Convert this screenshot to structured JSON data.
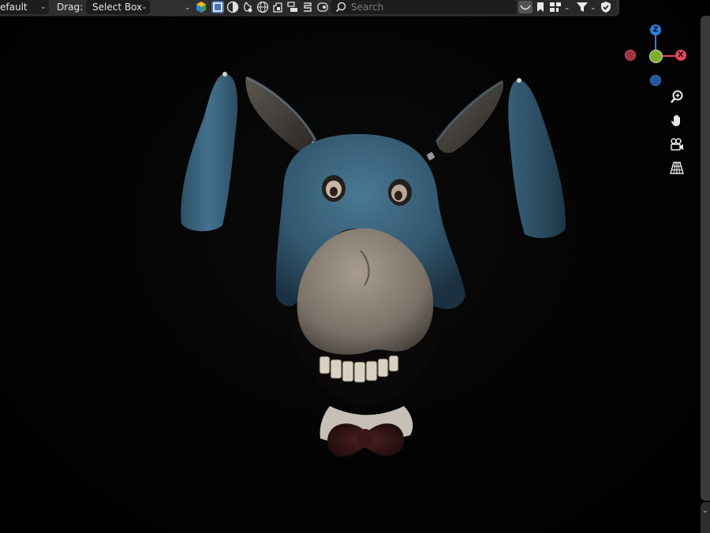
{
  "header": {
    "mode_value": "efault",
    "drag_label": "Drag:",
    "drag_value": "Select Box",
    "search_placeholder": "Search"
  },
  "icons": {
    "tools": [
      "object-type-icon",
      "select-box-icon",
      "sphere-icon",
      "paint-icon",
      "world-icon",
      "object-data-icon",
      "layers-icon",
      "list-icon",
      "image-icon"
    ],
    "filters": [
      "hide-icon",
      "bookmark-icon",
      "hierarchy-icon",
      "filter-icon",
      "shield-icon"
    ],
    "nav": [
      "zoom-icon",
      "hand-pan-icon",
      "camera-icon",
      "grid-perspective-icon"
    ]
  },
  "gizmo": {
    "z_label": "Z",
    "x_label": "X",
    "colors": {
      "x": "#e5455b",
      "y": "#7fae2e",
      "z": "#2c7ed8"
    }
  },
  "colors": {
    "header_bg": "#303030",
    "accent": "#4772b3",
    "viewport_bg": "#000000",
    "mascot_blue": "#3f6a86",
    "mascot_snout": "#8d8276"
  }
}
